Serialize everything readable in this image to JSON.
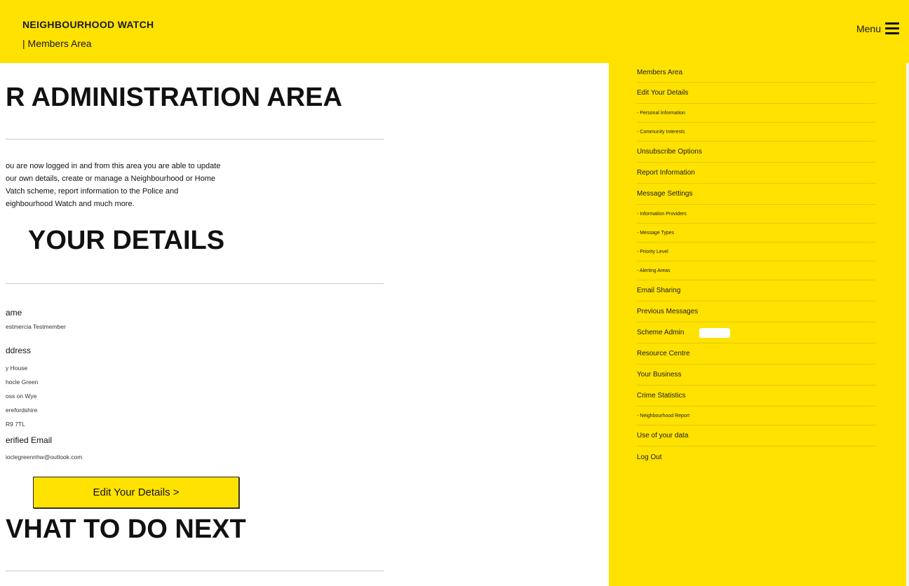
{
  "header": {
    "brand_title": "NEIGHBOURHOOD WATCH",
    "brand_sub": "| Members Area",
    "menu_label": "Menu"
  },
  "main": {
    "admin_heading": "R ADMINISTRATION AREA",
    "intro_lines": [
      "ou are now logged in and from this area you are able to update",
      "our own details, create or manage a Neighbourhood or Home",
      "Vatch scheme, report information to the Police and",
      "eighbourhood Watch and much more."
    ],
    "details_heading": "YOUR DETAILS",
    "name_label": "ame",
    "name_value": "estmercia Testmember",
    "address_label": "ddress",
    "address_lines": [
      "y House",
      "hocle Green",
      "oss on Wye",
      "erefordshire",
      "R9 7TL"
    ],
    "email_label": "erified Email",
    "email_value": "ioclegreennhw@outlook.com",
    "edit_button": "Edit Your Details >",
    "next_heading": "VHAT TO DO NEXT"
  },
  "sidebar": {
    "items": [
      {
        "label": "Members Area",
        "sub": false
      },
      {
        "label": "Edit Your Details",
        "sub": false
      },
      {
        "label": "- Personal Information",
        "sub": true
      },
      {
        "label": "- Community Interests",
        "sub": true
      },
      {
        "label": "Unsubscribe Options",
        "sub": false
      },
      {
        "label": "Report Information",
        "sub": false
      },
      {
        "label": "Message Settings",
        "sub": false
      },
      {
        "label": "- Information Providers",
        "sub": true
      },
      {
        "label": "- Message Types",
        "sub": true
      },
      {
        "label": "- Priority Level",
        "sub": true
      },
      {
        "label": "- Alerting Areas",
        "sub": true
      },
      {
        "label": "Email Sharing",
        "sub": false
      },
      {
        "label": "Previous Messages",
        "sub": false
      },
      {
        "label": "Scheme Admin",
        "sub": false
      },
      {
        "label": "Resource Centre",
        "sub": false
      },
      {
        "label": "Your Business",
        "sub": false
      },
      {
        "label": "Crime Statistics",
        "sub": false
      },
      {
        "label": "- Neighbourhood Report",
        "sub": true
      },
      {
        "label": "Use of your data",
        "sub": false
      },
      {
        "label": "Log Out",
        "sub": false
      }
    ]
  },
  "colors": {
    "accent": "#ffe200"
  }
}
